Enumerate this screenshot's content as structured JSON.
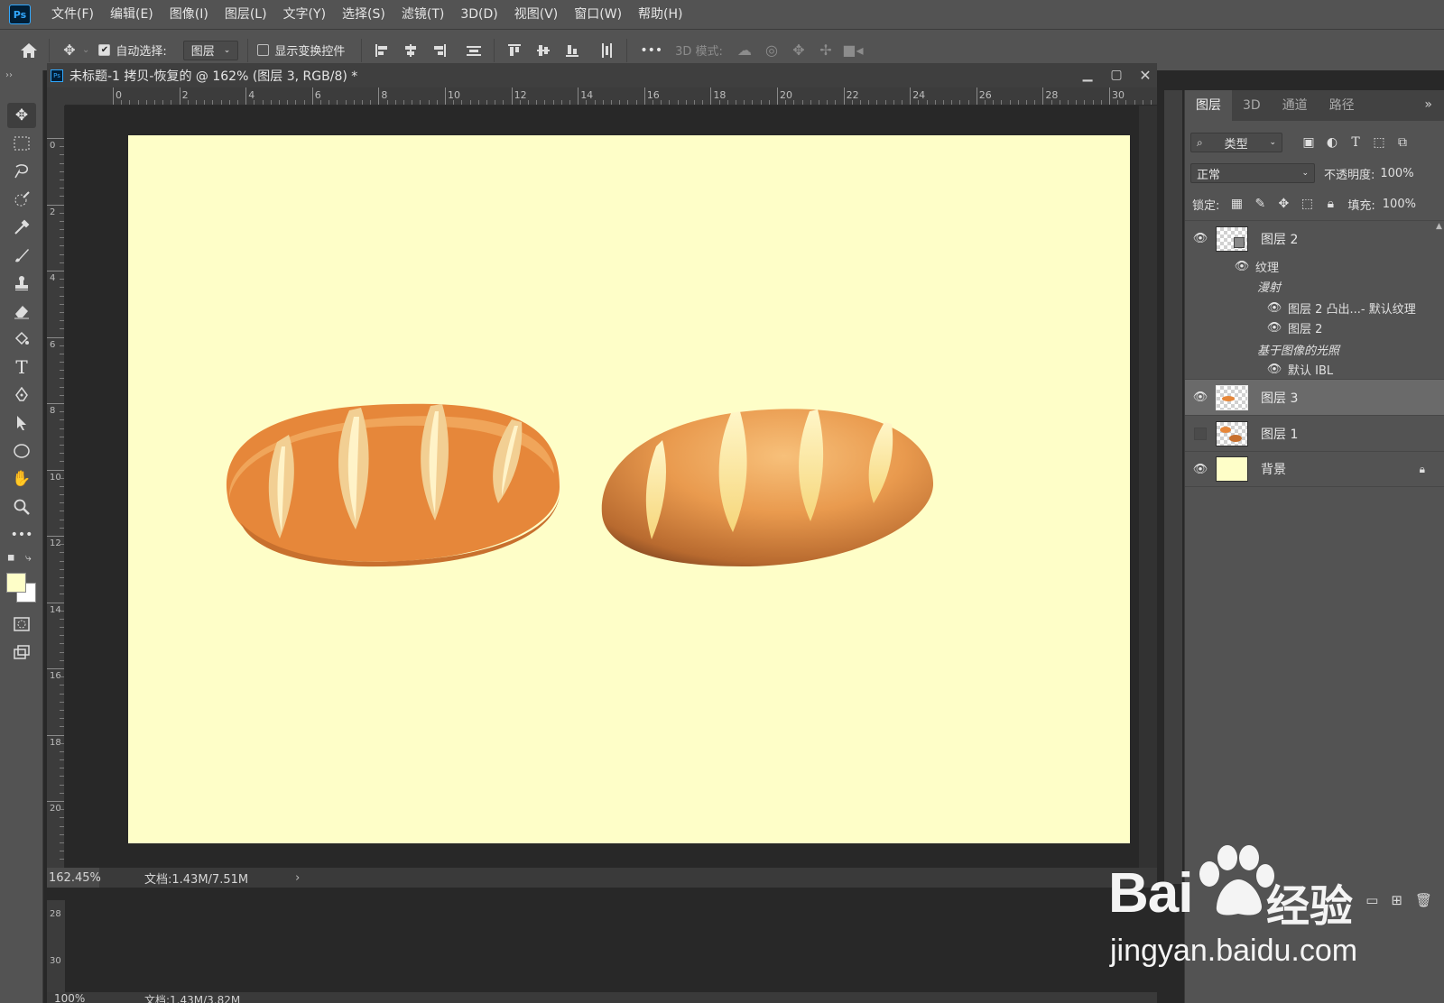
{
  "app": {
    "logo": "Ps",
    "menu": [
      "文件(F)",
      "编辑(E)",
      "图像(I)",
      "图层(L)",
      "文字(Y)",
      "选择(S)",
      "滤镜(T)",
      "3D(D)",
      "视图(V)",
      "窗口(W)",
      "帮助(H)"
    ]
  },
  "options": {
    "auto_select_label": "自动选择:",
    "auto_select_checked": true,
    "auto_select_target": "图层",
    "show_transform_label": "显示变换控件",
    "show_transform_checked": false,
    "more": "•••",
    "mode_3d_label": "3D 模式:"
  },
  "document": {
    "title": "未标题-1 拷贝-恢复的 @ 162% (图层 3, RGB/8) *",
    "ruler_top": [
      "0",
      "2",
      "4",
      "6",
      "8",
      "10",
      "12",
      "14",
      "16",
      "18",
      "20",
      "22",
      "24",
      "26",
      "28",
      "30"
    ],
    "ruler_left": [
      "0",
      "2",
      "4",
      "6",
      "8",
      "10",
      "12",
      "14",
      "16",
      "18",
      "20"
    ],
    "zoom": "162.45%",
    "info": "文档:1.43M/7.51M",
    "canvas_color": "#fefec8"
  },
  "document2": {
    "zoom": "100%",
    "info": "文档:1.43M/3.82M",
    "ruler_left": [
      "28",
      "30"
    ]
  },
  "panel": {
    "tabs": [
      "图层",
      "3D",
      "通道",
      "路径"
    ],
    "active_tab": "图层",
    "filter_label": "类型",
    "blend_mode": "正常",
    "opacity_label": "不透明度:",
    "opacity": "100%",
    "lock_label": "锁定:",
    "fill_label": "填充:",
    "fill": "100%",
    "layers": [
      {
        "name": "图层 2",
        "visible": true,
        "type": "3d"
      },
      {
        "name": "图层 3",
        "visible": true,
        "selected": true,
        "type": "bread"
      },
      {
        "name": "图层 1",
        "visible": false,
        "type": "bread2"
      },
      {
        "name": "背景",
        "visible": true,
        "locked": true,
        "type": "bg"
      }
    ],
    "sublayers": {
      "texture": "纹理",
      "diffuse": "漫射",
      "tex1": "图层 2 凸出...- 默认纹理",
      "tex2": "图层 2",
      "ibl_group": "基于图像的光照",
      "ibl": "默认 IBL"
    }
  },
  "watermark": {
    "brand": "Bai",
    "suffix": "经验",
    "url": "jingyan.baidu.com"
  }
}
